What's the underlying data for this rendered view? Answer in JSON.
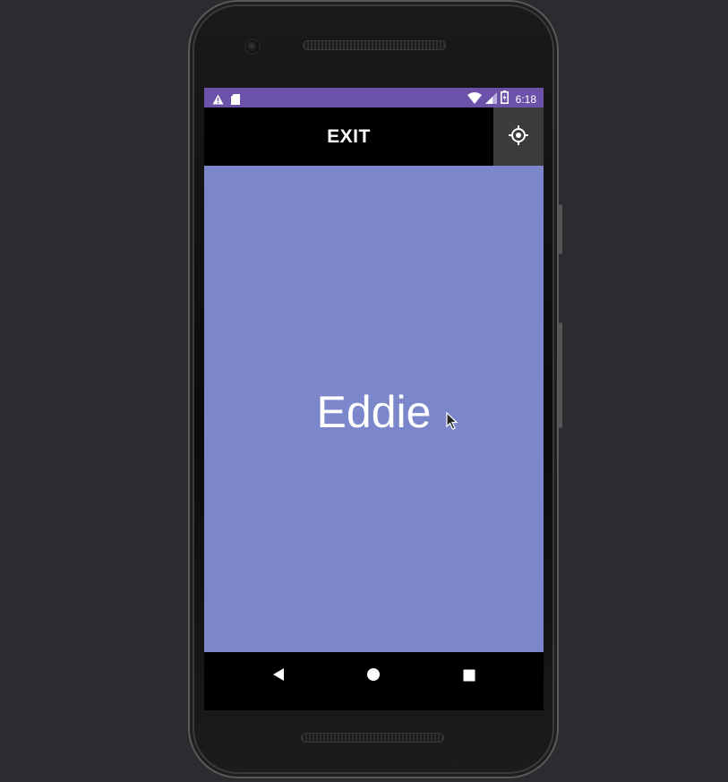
{
  "status_bar": {
    "time": "6:18",
    "left_icons": [
      "warning-icon",
      "sd-card-icon"
    ],
    "right_icons": [
      "wifi-icon",
      "cellular-signal-icon",
      "battery-icon"
    ]
  },
  "app_bar": {
    "exit_label": "EXIT",
    "settings_icon": "gps-target-icon"
  },
  "content": {
    "name": "Eddie",
    "background": "#7b86cb"
  },
  "nav_bar": {
    "icons": [
      "back-icon",
      "home-icon",
      "recents-icon"
    ]
  },
  "colors": {
    "status_bar": "#6b51a8",
    "app_bar": "#000000",
    "settings_button": "#3c3c3c",
    "content": "#7b86cb"
  }
}
